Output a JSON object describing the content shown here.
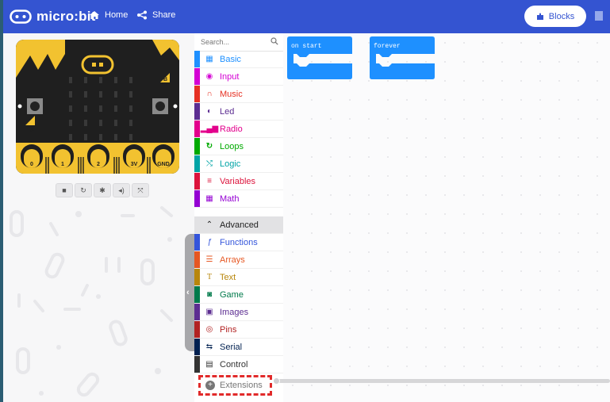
{
  "topbar": {
    "brand": "micro:bit",
    "home_label": "Home",
    "share_label": "Share",
    "blocks_label": "Blocks",
    "background": "#3454d1"
  },
  "simulator": {
    "pins": [
      "0",
      "1",
      "2",
      "3V",
      "GND"
    ],
    "button_labels": {
      "a": "A",
      "b": "B"
    },
    "controls": [
      "stop-icon",
      "restart-icon",
      "debug-icon",
      "sound-icon",
      "fullscreen-icon"
    ]
  },
  "toolbox": {
    "search_placeholder": "Search...",
    "categories": [
      {
        "label": "Basic",
        "color": "#1e90ff",
        "icon": "grid-icon"
      },
      {
        "label": "Input",
        "color": "#d400d4",
        "icon": "target-icon"
      },
      {
        "label": "Music",
        "color": "#e63022",
        "icon": "headphones-icon"
      },
      {
        "label": "Led",
        "color": "#5c2d91",
        "icon": "toggle-icon"
      },
      {
        "label": "Radio",
        "color": "#e3008c",
        "icon": "signal-icon"
      },
      {
        "label": "Loops",
        "color": "#00aa00",
        "icon": "refresh-icon"
      },
      {
        "label": "Logic",
        "color": "#00a4a6",
        "icon": "shuffle-icon"
      },
      {
        "label": "Variables",
        "color": "#dc143c",
        "icon": "list-icon"
      },
      {
        "label": "Math",
        "color": "#9400d3",
        "icon": "calculator-icon"
      }
    ],
    "advanced": {
      "label": "Advanced"
    },
    "advanced_categories": [
      {
        "label": "Functions",
        "color": "#3455db",
        "icon": "function-icon"
      },
      {
        "label": "Arrays",
        "color": "#e65722",
        "icon": "arrays-icon"
      },
      {
        "label": "Text",
        "color": "#b8860b",
        "icon": "text-icon"
      },
      {
        "label": "Game",
        "color": "#007a4b",
        "icon": "gamepad-icon"
      },
      {
        "label": "Images",
        "color": "#5c2d91",
        "icon": "image-icon"
      },
      {
        "label": "Pins",
        "color": "#b22222",
        "icon": "pin-icon"
      },
      {
        "label": "Serial",
        "color": "#002050",
        "icon": "usb-icon"
      },
      {
        "label": "Control",
        "color": "#333333",
        "icon": "control-icon"
      }
    ],
    "extensions": {
      "label": "Extensions"
    }
  },
  "workspace": {
    "blocks": [
      {
        "label": "on start",
        "color": "#1e90ff"
      },
      {
        "label": "forever",
        "color": "#1e90ff"
      }
    ]
  }
}
